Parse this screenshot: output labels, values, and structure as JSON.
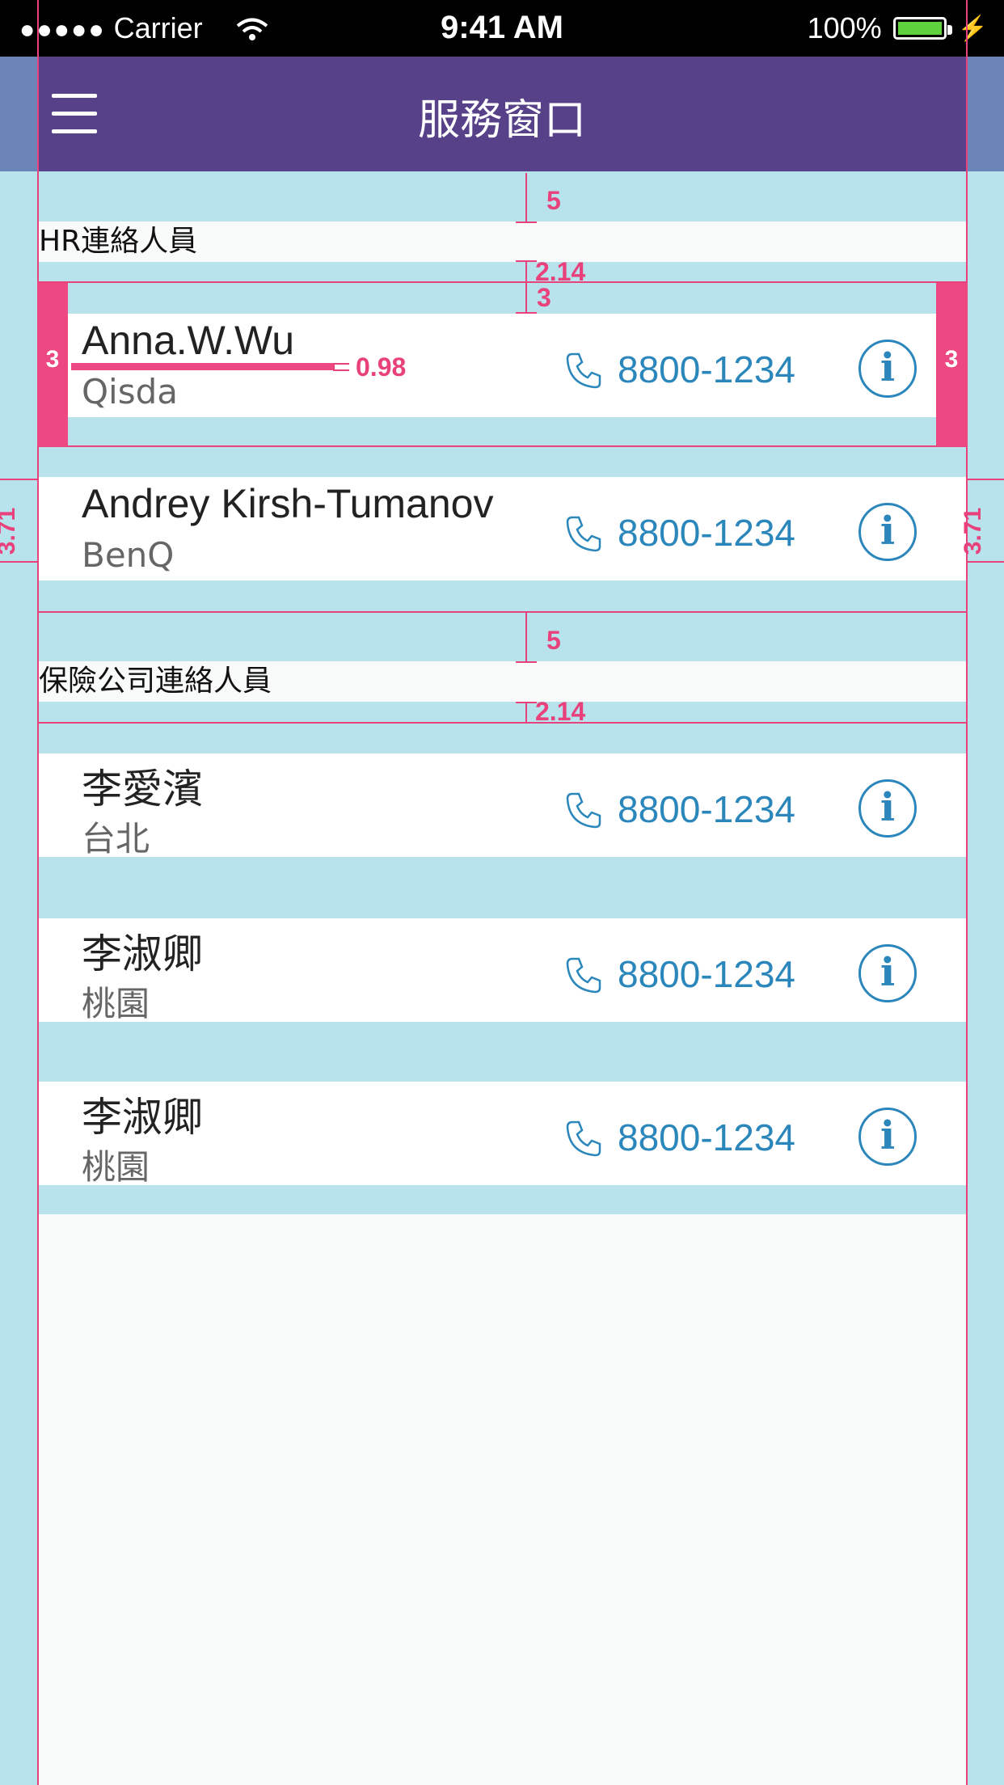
{
  "status_bar": {
    "dots": "●●●●●",
    "carrier": "Carrier",
    "time": "9:41 AM",
    "battery": "100%"
  },
  "header": {
    "title": "服務窗口",
    "menu_icon": "hamburger-menu-icon"
  },
  "sections": [
    {
      "label": "HR連絡人員",
      "contacts": [
        {
          "name": "Anna.W.Wu",
          "company": "Qisda",
          "phone": "8800-1234",
          "info": "i"
        },
        {
          "name": "Andrey Kirsh-Tumanov",
          "company": "BenQ",
          "phone": "8800-1234",
          "info": "i"
        }
      ]
    },
    {
      "label": "保險公司連絡人員",
      "contacts": [
        {
          "name": "李愛濱",
          "company": "台北",
          "phone": "8800-1234",
          "info": "i"
        },
        {
          "name": "李淑卿",
          "company": "桃園",
          "phone": "8800-1234",
          "info": "i"
        },
        {
          "name": "李淑卿",
          "company": "桃園",
          "phone": "8800-1234",
          "info": "i"
        }
      ]
    }
  ],
  "annotations": {
    "gap_top": "5",
    "label_gap": "2.14",
    "row_gap": "3",
    "side_l": "3",
    "side_r": "3",
    "underline": "0.98",
    "margin_l": "3.71",
    "margin_r": "3.71",
    "gap_top_2": "5",
    "label_gap_2": "2.14"
  },
  "colors": {
    "header": "#574189",
    "band": "#b9e3ec",
    "accent": "#2b87bb",
    "annotation": "#e8417b"
  }
}
